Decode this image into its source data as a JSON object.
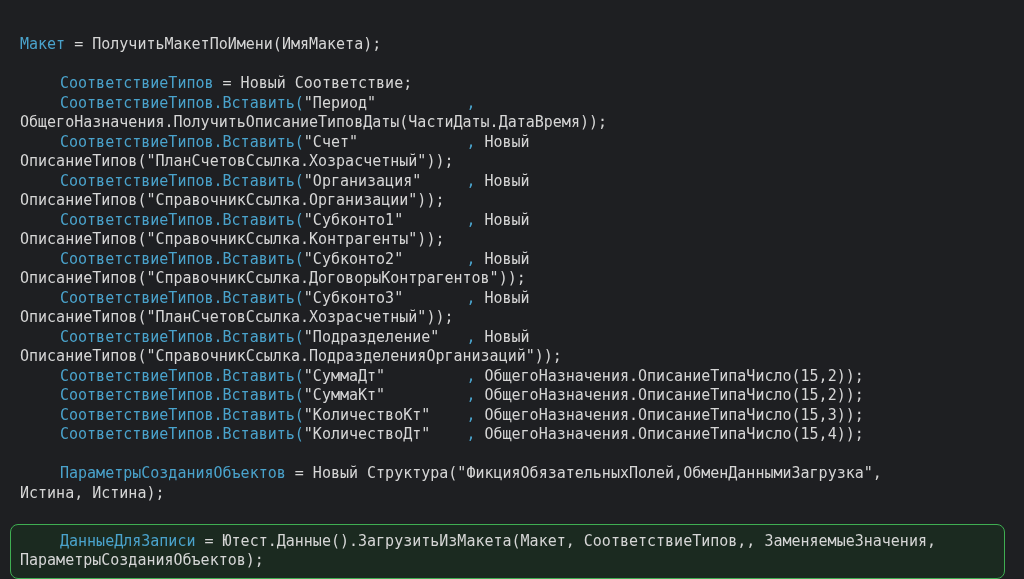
{
  "code_lines": [
    {
      "kind": "code",
      "indented": false,
      "highlighted": false,
      "segments": [
        {
          "kind": "ident",
          "text": "Макет"
        },
        {
          "kind": "plain",
          "text": " = ПолучитьМакетПоИмени(ИмяМакета);"
        }
      ]
    },
    {
      "kind": "blank"
    },
    {
      "kind": "code",
      "indented": true,
      "highlighted": false,
      "segments": [
        {
          "kind": "ident",
          "text": "СоответствиеТипов"
        },
        {
          "kind": "plain",
          "text": " = Новый Соответствие;"
        }
      ]
    },
    {
      "kind": "code",
      "indented": true,
      "highlighted": false,
      "segments": [
        {
          "kind": "ident",
          "text": "СоответствиеТипов.Вставить("
        },
        {
          "kind": "plain",
          "text": "\"Период\"          "
        },
        {
          "kind": "ident",
          "text": ","
        }
      ]
    },
    {
      "kind": "code",
      "indented": false,
      "highlighted": false,
      "segments": [
        {
          "kind": "plain",
          "text": "ОбщегоНазначения.ПолучитьОписаниеТиповДаты(ЧастиДаты.ДатаВремя));"
        }
      ]
    },
    {
      "kind": "code",
      "indented": true,
      "highlighted": false,
      "segments": [
        {
          "kind": "ident",
          "text": "СоответствиеТипов.Вставить("
        },
        {
          "kind": "plain",
          "text": "\"Счет\"            "
        },
        {
          "kind": "ident",
          "text": ","
        },
        {
          "kind": "plain",
          "text": " Новый"
        }
      ]
    },
    {
      "kind": "code",
      "indented": false,
      "highlighted": false,
      "segments": [
        {
          "kind": "plain",
          "text": "ОписаниеТипов(\"ПланСчетовСсылка.Хозрасчетный\"));"
        }
      ]
    },
    {
      "kind": "code",
      "indented": true,
      "highlighted": false,
      "segments": [
        {
          "kind": "ident",
          "text": "СоответствиеТипов.Вставить("
        },
        {
          "kind": "plain",
          "text": "\"Организация\"     "
        },
        {
          "kind": "ident",
          "text": ","
        },
        {
          "kind": "plain",
          "text": " Новый"
        }
      ]
    },
    {
      "kind": "code",
      "indented": false,
      "highlighted": false,
      "segments": [
        {
          "kind": "plain",
          "text": "ОписаниеТипов(\"СправочникСсылка.Организации\"));"
        }
      ]
    },
    {
      "kind": "code",
      "indented": true,
      "highlighted": false,
      "segments": [
        {
          "kind": "ident",
          "text": "СоответствиеТипов.Вставить("
        },
        {
          "kind": "plain",
          "text": "\"Субконто1\"       "
        },
        {
          "kind": "ident",
          "text": ","
        },
        {
          "kind": "plain",
          "text": " Новый"
        }
      ]
    },
    {
      "kind": "code",
      "indented": false,
      "highlighted": false,
      "segments": [
        {
          "kind": "plain",
          "text": "ОписаниеТипов(\"СправочникСсылка.Контрагенты\"));"
        }
      ]
    },
    {
      "kind": "code",
      "indented": true,
      "highlighted": false,
      "segments": [
        {
          "kind": "ident",
          "text": "СоответствиеТипов.Вставить("
        },
        {
          "kind": "plain",
          "text": "\"Субконто2\"       "
        },
        {
          "kind": "ident",
          "text": ","
        },
        {
          "kind": "plain",
          "text": " Новый"
        }
      ]
    },
    {
      "kind": "code",
      "indented": false,
      "highlighted": false,
      "segments": [
        {
          "kind": "plain",
          "text": "ОписаниеТипов(\"СправочникСсылка.ДоговорыКонтрагентов\"));"
        }
      ]
    },
    {
      "kind": "code",
      "indented": true,
      "highlighted": false,
      "segments": [
        {
          "kind": "ident",
          "text": "СоответствиеТипов.Вставить("
        },
        {
          "kind": "plain",
          "text": "\"Субконто3\"       "
        },
        {
          "kind": "ident",
          "text": ","
        },
        {
          "kind": "plain",
          "text": " Новый"
        }
      ]
    },
    {
      "kind": "code",
      "indented": false,
      "highlighted": false,
      "segments": [
        {
          "kind": "plain",
          "text": "ОписаниеТипов(\"ПланСчетовСсылка.Хозрасчетный\"));"
        }
      ]
    },
    {
      "kind": "code",
      "indented": true,
      "highlighted": false,
      "segments": [
        {
          "kind": "ident",
          "text": "СоответствиеТипов.Вставить("
        },
        {
          "kind": "plain",
          "text": "\"Подразделение\"   "
        },
        {
          "kind": "ident",
          "text": ","
        },
        {
          "kind": "plain",
          "text": " Новый"
        }
      ]
    },
    {
      "kind": "code",
      "indented": false,
      "highlighted": false,
      "segments": [
        {
          "kind": "plain",
          "text": "ОписаниеТипов(\"СправочникСсылка.ПодразделенияОрганизаций\"));"
        }
      ]
    },
    {
      "kind": "code",
      "indented": true,
      "highlighted": false,
      "segments": [
        {
          "kind": "ident",
          "text": "СоответствиеТипов.Вставить("
        },
        {
          "kind": "plain",
          "text": "\"СуммаДт\"         "
        },
        {
          "kind": "ident",
          "text": ","
        },
        {
          "kind": "plain",
          "text": " ОбщегоНазначения.ОписаниеТипаЧисло(15,2));"
        }
      ]
    },
    {
      "kind": "code",
      "indented": true,
      "highlighted": false,
      "segments": [
        {
          "kind": "ident",
          "text": "СоответствиеТипов.Вставить("
        },
        {
          "kind": "plain",
          "text": "\"СуммаКт\"         "
        },
        {
          "kind": "ident",
          "text": ","
        },
        {
          "kind": "plain",
          "text": " ОбщегоНазначения.ОписаниеТипаЧисло(15,2));"
        }
      ]
    },
    {
      "kind": "code",
      "indented": true,
      "highlighted": false,
      "segments": [
        {
          "kind": "ident",
          "text": "СоответствиеТипов.Вставить("
        },
        {
          "kind": "plain",
          "text": "\"КоличествоКт\"    "
        },
        {
          "kind": "ident",
          "text": ","
        },
        {
          "kind": "plain",
          "text": " ОбщегоНазначения.ОписаниеТипаЧисло(15,3));"
        }
      ]
    },
    {
      "kind": "code",
      "indented": true,
      "highlighted": false,
      "segments": [
        {
          "kind": "ident",
          "text": "СоответствиеТипов.Вставить("
        },
        {
          "kind": "plain",
          "text": "\"КоличествоДт\"    "
        },
        {
          "kind": "ident",
          "text": ","
        },
        {
          "kind": "plain",
          "text": " ОбщегоНазначения.ОписаниеТипаЧисло(15,4));"
        }
      ]
    },
    {
      "kind": "blank"
    },
    {
      "kind": "code",
      "indented": true,
      "highlighted": false,
      "segments": [
        {
          "kind": "ident",
          "text": "ПараметрыСозданияОбъектов"
        },
        {
          "kind": "plain",
          "text": " = Новый Структура(\"ФикцияОбязательныхПолей,ОбменДаннымиЗагрузка\","
        }
      ]
    },
    {
      "kind": "code",
      "indented": false,
      "highlighted": false,
      "segments": [
        {
          "kind": "plain",
          "text": "Истина, Истина);"
        }
      ]
    },
    {
      "kind": "blank"
    },
    {
      "kind": "code",
      "indented": true,
      "highlighted": true,
      "segments": [
        {
          "kind": "ident",
          "text": "ДанныеДляЗаписи"
        },
        {
          "kind": "plain",
          "text": " = Ютест.Данные().ЗагрузитьИзМакета(Макет, СоответствиеТипов,, ЗаменяемыеЗначения,"
        }
      ]
    },
    {
      "kind": "code",
      "indented": false,
      "highlighted": true,
      "segments": [
        {
          "kind": "plain",
          "text": "ПараметрыСозданияОбъектов);"
        }
      ]
    }
  ]
}
